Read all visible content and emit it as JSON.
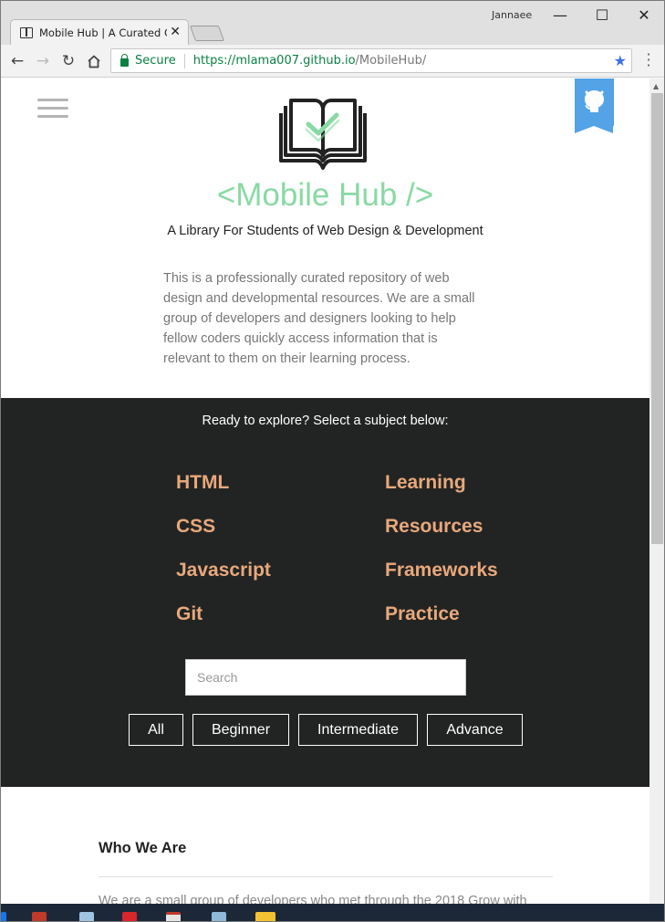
{
  "window": {
    "user_name": "Jannaee",
    "tab_title": "Mobile Hub | A Curated C",
    "controls": {
      "minimize": "—",
      "maximize": "☐",
      "close": "✕"
    }
  },
  "toolbar": {
    "secure_label": "Secure",
    "url_scheme": "https://",
    "url_host": "mlama007.github.io",
    "url_path": "/MobileHub/"
  },
  "site": {
    "title": "<Mobile Hub />",
    "tagline": "A Library For Students of Web Design & Development",
    "intro": "This is a professionally curated repository of web design and developmental resources. We are a small group of developers and designers looking to help fellow coders quickly access information that is relevant to them on their learning process.",
    "accent_color": "#89d9a3"
  },
  "explore": {
    "prompt": "Ready to explore? Select a subject below:",
    "subjects_left": [
      "HTML",
      "CSS",
      "Javascript",
      "Git"
    ],
    "subjects_right": [
      "Learning",
      "Resources",
      "Frameworks",
      "Practice"
    ],
    "subject_color": "#e8a87c",
    "search_placeholder": "Search",
    "filters": [
      "All",
      "Beginner",
      "Intermediate",
      "Advance"
    ]
  },
  "about": {
    "heading": "Who We Are",
    "text": "We are a small group of developers who met through the 2018 Grow with"
  },
  "icons": {
    "menu": "hamburger-icon",
    "github": "github-octocat-icon",
    "logo": "open-book-check-icon"
  }
}
